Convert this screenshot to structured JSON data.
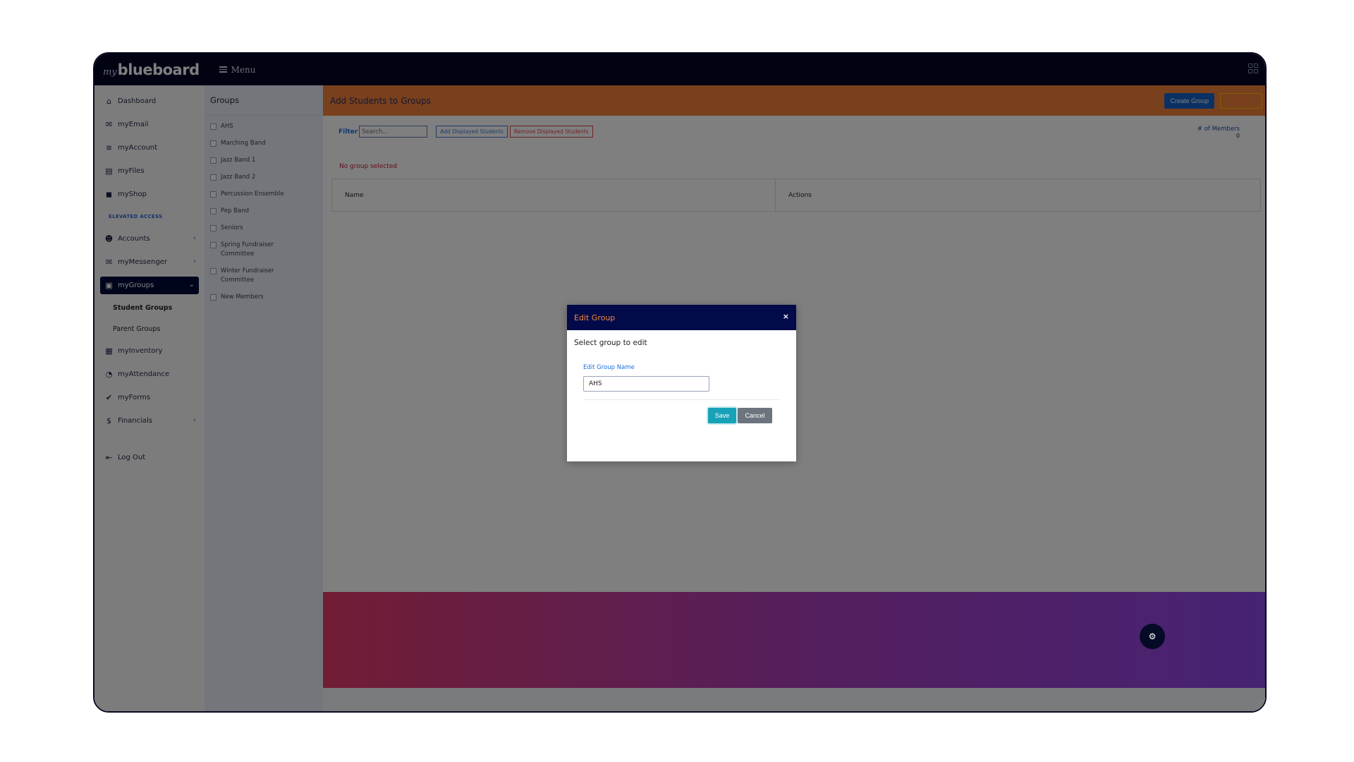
{
  "topbar": {
    "logo_prefix": "my",
    "logo_name": "blueboard",
    "menu_label": "Menu"
  },
  "sidebar": {
    "items_top": [
      {
        "label": "Dashboard",
        "icon": "home-icon",
        "glyph": "⌂"
      },
      {
        "label": "myEmail",
        "icon": "inbox-icon",
        "glyph": "✉"
      },
      {
        "label": "myAccount",
        "icon": "database-icon",
        "glyph": "≋"
      },
      {
        "label": "myFiles",
        "icon": "file-icon",
        "glyph": "▤"
      },
      {
        "label": "myShop",
        "icon": "shopping-bag-icon",
        "glyph": "◼"
      }
    ],
    "section_label": "ELEVATED ACCESS",
    "items_elevated": [
      {
        "label": "Accounts",
        "icon": "users-icon",
        "glyph": "☻"
      },
      {
        "label": "myMessenger",
        "icon": "envelope-icon",
        "glyph": "✉"
      },
      {
        "label": "myGroups",
        "icon": "group-icon",
        "glyph": "▣"
      }
    ],
    "sub_items": [
      "Student Groups",
      "Parent Groups"
    ],
    "items_bottom": [
      {
        "label": "myInventory",
        "icon": "archive-icon",
        "glyph": "▦"
      },
      {
        "label": "myAttendance",
        "icon": "clock-icon",
        "glyph": "◔"
      },
      {
        "label": "myForms",
        "icon": "clipboard-check-icon",
        "glyph": "✔"
      },
      {
        "label": "Financials",
        "icon": "money-icon",
        "glyph": "$"
      }
    ],
    "logout_label": "Log Out"
  },
  "groups": {
    "title": "Groups",
    "items": [
      "AHS",
      "Marching Band",
      "Jazz Band 1",
      "Jazz Band 2",
      "Percussion Ensemble",
      "Pep Band",
      "Seniors",
      "Spring Fundraiser Committee",
      "Winter Fundraiser Committee",
      "New Members"
    ]
  },
  "main": {
    "title": "Add Students to Groups",
    "create_button": "Create Group",
    "filter_label": "Filter",
    "filter_placeholder": "Search...",
    "add_button": "Add Displayed Students",
    "remove_button": "Remove Displayed Students",
    "members_label": "# of Members",
    "members_count": "0",
    "no_group_text": "No group selected",
    "table_headers": [
      "Name",
      "Actions"
    ]
  },
  "modal": {
    "title": "Edit Group",
    "close_glyph": "×",
    "subtitle": "Select group to edit",
    "field_label": "Edit Group Name",
    "field_value": "AHS",
    "save_label": "Save",
    "cancel_label": "Cancel"
  },
  "colors": {
    "navbar": "#020627",
    "header_orange": "#f08038",
    "primary_blue": "#1662c9",
    "modal_header": "#030a4a",
    "save_teal": "#17a2b8"
  }
}
